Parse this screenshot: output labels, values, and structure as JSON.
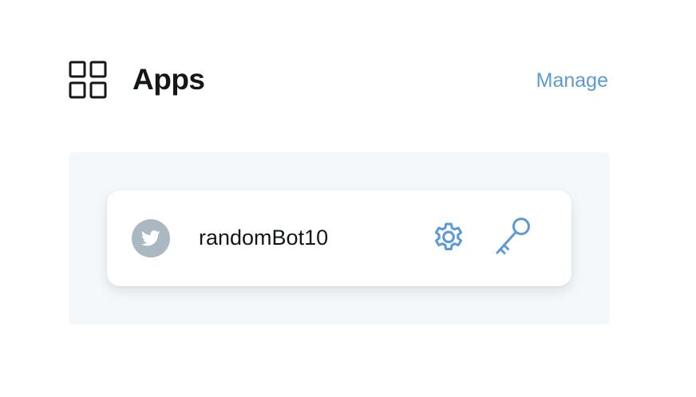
{
  "header": {
    "title": "Apps",
    "manage_label": "Manage",
    "icon": "apps-grid-icon"
  },
  "apps": [
    {
      "name": "randomBot10",
      "avatar_icon": "twitter-bird-icon",
      "actions": [
        {
          "icon": "gear-icon",
          "label": "settings"
        },
        {
          "icon": "key-icon",
          "label": "keys"
        }
      ]
    }
  ],
  "colors": {
    "accent": "#5b9bd5",
    "text": "#14171a",
    "panel_background": "#f5f8fa",
    "avatar_background": "#aab8c2"
  }
}
